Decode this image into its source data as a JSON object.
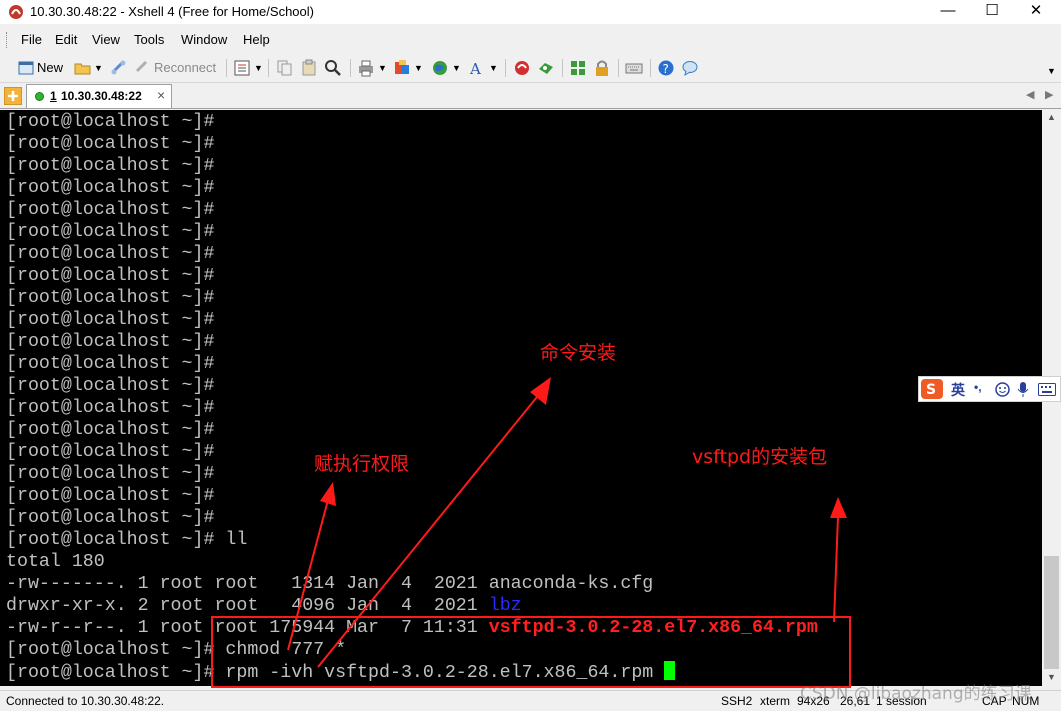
{
  "window": {
    "title": "10.30.30.48:22 - Xshell 4 (Free for Home/School)",
    "minimize_glyph": "—",
    "maximize_glyph": "☐",
    "close_glyph": "✕"
  },
  "menu": [
    "File",
    "Edit",
    "View",
    "Tools",
    "Window",
    "Help"
  ],
  "toolbar": {
    "new_label": "New",
    "reconnect_label": "Reconnect"
  },
  "tab": {
    "number": "1",
    "label": "10.30.30.48:22",
    "close_glyph": "×"
  },
  "terminal": {
    "prompt_lines": [
      "[root@localhost ~]#",
      "[root@localhost ~]#",
      "[root@localhost ~]#",
      "[root@localhost ~]#",
      "[root@localhost ~]#",
      "[root@localhost ~]#",
      "[root@localhost ~]#",
      "[root@localhost ~]#",
      "[root@localhost ~]#",
      "[root@localhost ~]#",
      "[root@localhost ~]#",
      "[root@localhost ~]#",
      "[root@localhost ~]#",
      "[root@localhost ~]#",
      "[root@localhost ~]#",
      "[root@localhost ~]#",
      "[root@localhost ~]#",
      "[root@localhost ~]#",
      "[root@localhost ~]#"
    ],
    "ll_line": "[root@localhost ~]# ll",
    "total_line": "total 180",
    "listing": [
      {
        "prefix": "-rw-------. 1 root root   1314 Jan  4  2021 ",
        "name": "anaconda-ks.cfg",
        "color": "#c0c0c0"
      },
      {
        "prefix": "drwxr-xr-x. 2 root root   4096 Jan  4  2021 ",
        "name": "lbz",
        "color": "#2b2bff"
      },
      {
        "prefix": "-rw-r--r--. 1 root root 175944 Mar  7 11:31 ",
        "name": "vsftpd-3.0.2-28.el7.x86_64.rpm",
        "color": "#ff2020"
      }
    ],
    "chmod_line": "[root@localhost ~]# chmod 777 *",
    "rpm_line": "[root@localhost ~]# rpm -ivh vsftpd-3.0.2-28.el7.x86_64.rpm ",
    "cursor_color": "#00ff00"
  },
  "annotations": {
    "install_cmd": "命令安装",
    "exec_perm": "赋执行权限",
    "package": "vsftpd的安装包",
    "color": "#ff1a1a"
  },
  "ime": {
    "mode": "英",
    "punct": "•,"
  },
  "status": {
    "connected": "Connected to 10.30.30.48:22.",
    "protocol": "SSH2",
    "term_type": "xterm",
    "size": "94x26",
    "cursor_pos": "26,61",
    "sessions": "1 session",
    "cap": "CAP",
    "num": "NUM"
  },
  "watermark": "CSDN @libaozhang的练习课"
}
